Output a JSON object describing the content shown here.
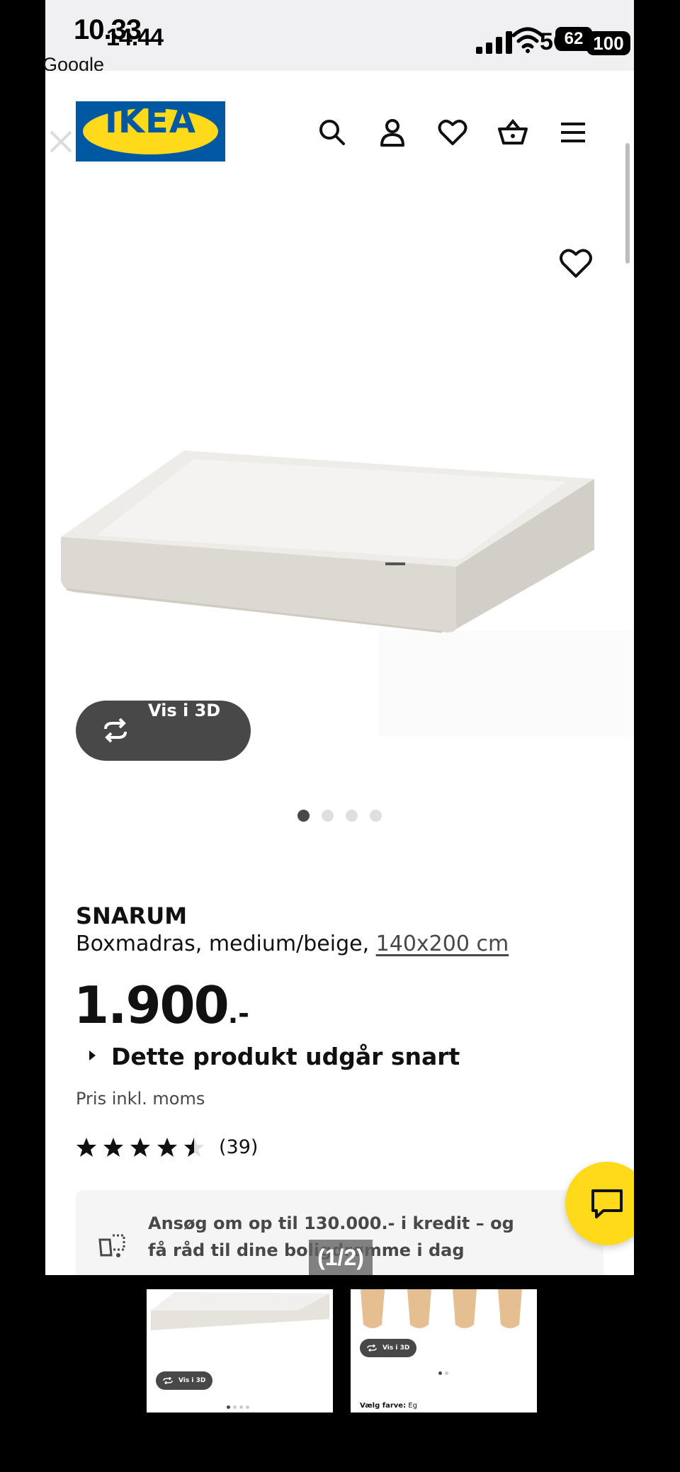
{
  "status_bar": {
    "time_old": "10.33",
    "time": "14.44",
    "back_app": "Google",
    "network": "5G",
    "battery_old": "62",
    "battery": "100"
  },
  "header": {
    "logo_text": "IKEA",
    "icons": [
      "search-icon",
      "account-icon",
      "heart-icon",
      "basket-icon",
      "menu-icon"
    ]
  },
  "gallery": {
    "view_3d_label": "Vis i 3D",
    "dot_count": 4,
    "active_dot": 0,
    "page_counter": "(1/2)"
  },
  "product": {
    "name": "SNARUM",
    "description": "Boxmadras, medium/beige, ",
    "size_link": "140x200 cm",
    "price": "1.900",
    "price_suffix": ".-",
    "discontinued_notice": "Dette produkt udgår snart",
    "vat_note": "Pris inkl. moms",
    "rating": 4.5,
    "review_count": "(39)"
  },
  "credit": {
    "text": "Ansøg om op til 130.000.- i kredit – og få råd til dine boligdrømme i dag"
  },
  "thumbnails": [
    {
      "view_3d_label": "Vis i 3D"
    },
    {
      "view_3d_label": "Vis i 3D",
      "color_label": "Vælg farve:",
      "color_value": "Eg"
    }
  ],
  "colors": {
    "ikea_blue": "#0058a3",
    "ikea_yellow": "#ffda1a",
    "dark_button": "#484848"
  }
}
